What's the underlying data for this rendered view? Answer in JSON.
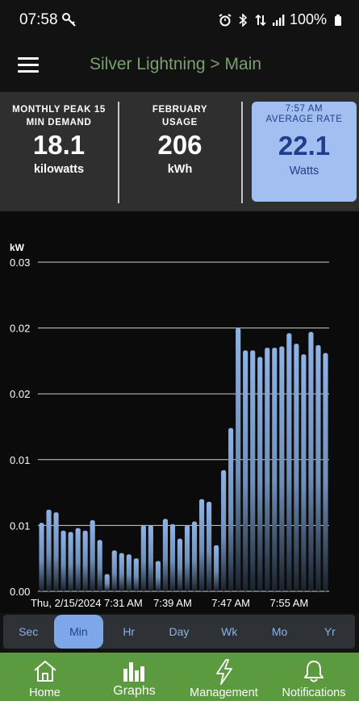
{
  "status_bar": {
    "time": "07:58",
    "battery": "100%"
  },
  "app_bar": {
    "title": "Silver Lightning > Main"
  },
  "summary": [
    {
      "label_line1": "MONTHLY PEAK 15",
      "label_line2": "MIN DEMAND",
      "value": "18.1",
      "unit": "kilowatts"
    },
    {
      "label_line1": "FEBRUARY",
      "label_line2": "USAGE",
      "value": "206",
      "unit": "kWh"
    },
    {
      "time": "7:57 AM",
      "label": "AVERAGE RATE",
      "value": "22.1",
      "unit": "Watts"
    }
  ],
  "chart_data": {
    "type": "bar",
    "ylabel": "kW",
    "ylim": [
      0,
      0.025
    ],
    "yticks": [
      0,
      0.005,
      0.01,
      0.015,
      0.02,
      0.025
    ],
    "ytick_labels": [
      "0.00",
      "0.01",
      "0.01",
      "0.01",
      "0.02",
      "0.02",
      "0.03"
    ],
    "ytick_values": [
      0,
      0.005,
      0.01,
      0.015,
      0.02,
      0.025
    ],
    "xtick_labels": [
      "Thu, 2/15/2024 7:31 AM",
      "7:39 AM",
      "7:47 AM",
      "7:55 AM"
    ],
    "xtick_index": [
      10,
      18,
      26,
      34
    ],
    "values": [
      0.0052,
      0.0062,
      0.006,
      0.0046,
      0.0045,
      0.0048,
      0.0046,
      0.0054,
      0.0039,
      0.0013,
      0.0031,
      0.0029,
      0.0028,
      0.0025,
      0.005,
      0.005,
      0.0023,
      0.0055,
      0.0051,
      0.004,
      0.005,
      0.0053,
      0.007,
      0.0068,
      0.0035,
      0.0092,
      0.0124,
      0.02,
      0.0183,
      0.0183,
      0.0178,
      0.0185,
      0.0185,
      0.0186,
      0.0196,
      0.0188,
      0.018,
      0.0197,
      0.0187,
      0.0181
    ],
    "grid": true,
    "bar_color": "#8fb3e6"
  },
  "range_tabs": [
    "Sec",
    "Min",
    "Hr",
    "Day",
    "Wk",
    "Mo",
    "Yr"
  ],
  "active_range": "Min",
  "nav": [
    {
      "label": "Home",
      "icon": "home-icon"
    },
    {
      "label": "Graphs",
      "icon": "graphs-icon"
    },
    {
      "label": "Management",
      "icon": "lightning-icon"
    },
    {
      "label": "Notifications",
      "icon": "bell-icon"
    }
  ],
  "colors": {
    "accent": "#7aa06e",
    "nav_bg": "#5b9a3e",
    "highlight_tile": "#a3bef0",
    "active_tab": "#7ea7ea"
  }
}
